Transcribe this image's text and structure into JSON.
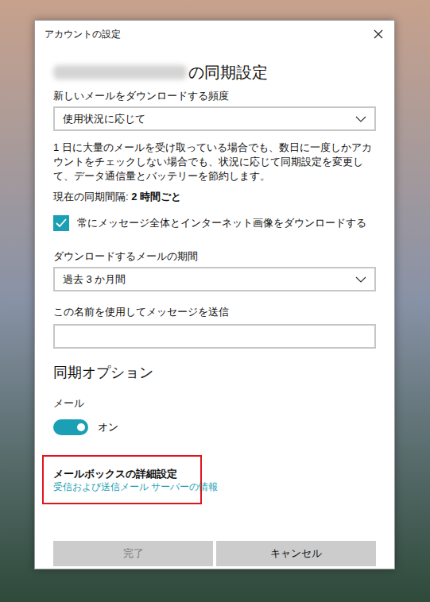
{
  "window": {
    "title": "アカウントの設定"
  },
  "heading": {
    "suffix": "の同期設定"
  },
  "frequency": {
    "label": "新しいメールをダウンロードする頻度",
    "value": "使用状況に応じて"
  },
  "description": "1 日に大量のメールを受け取っている場合でも、数日に一度しかアカウントをチェックしない場合でも、状況に応じて同期設定を変更して、データ通信量とバッテリーを節約します。",
  "interval": {
    "label": "現在の同期間隔: ",
    "value": "2 時間ごと"
  },
  "full_download": {
    "label": "常にメッセージ全体とインターネット画像をダウンロードする",
    "checked": true
  },
  "period": {
    "label": "ダウンロードするメールの期間",
    "value": "過去 3 か月間"
  },
  "sender_name": {
    "label": "この名前を使用してメッセージを送信",
    "value": ""
  },
  "sync_options": {
    "title": "同期オプション",
    "mail": {
      "label": "メール",
      "on": true,
      "state_label": "オン"
    }
  },
  "advanced": {
    "title": "メールボックスの詳細設定",
    "link": "受信および送信メール サーバーの情報",
    "highlighted": true
  },
  "buttons": [
    {
      "label": "完了",
      "disabled": true
    },
    {
      "label": "キャンセル",
      "disabled": false
    }
  ]
}
